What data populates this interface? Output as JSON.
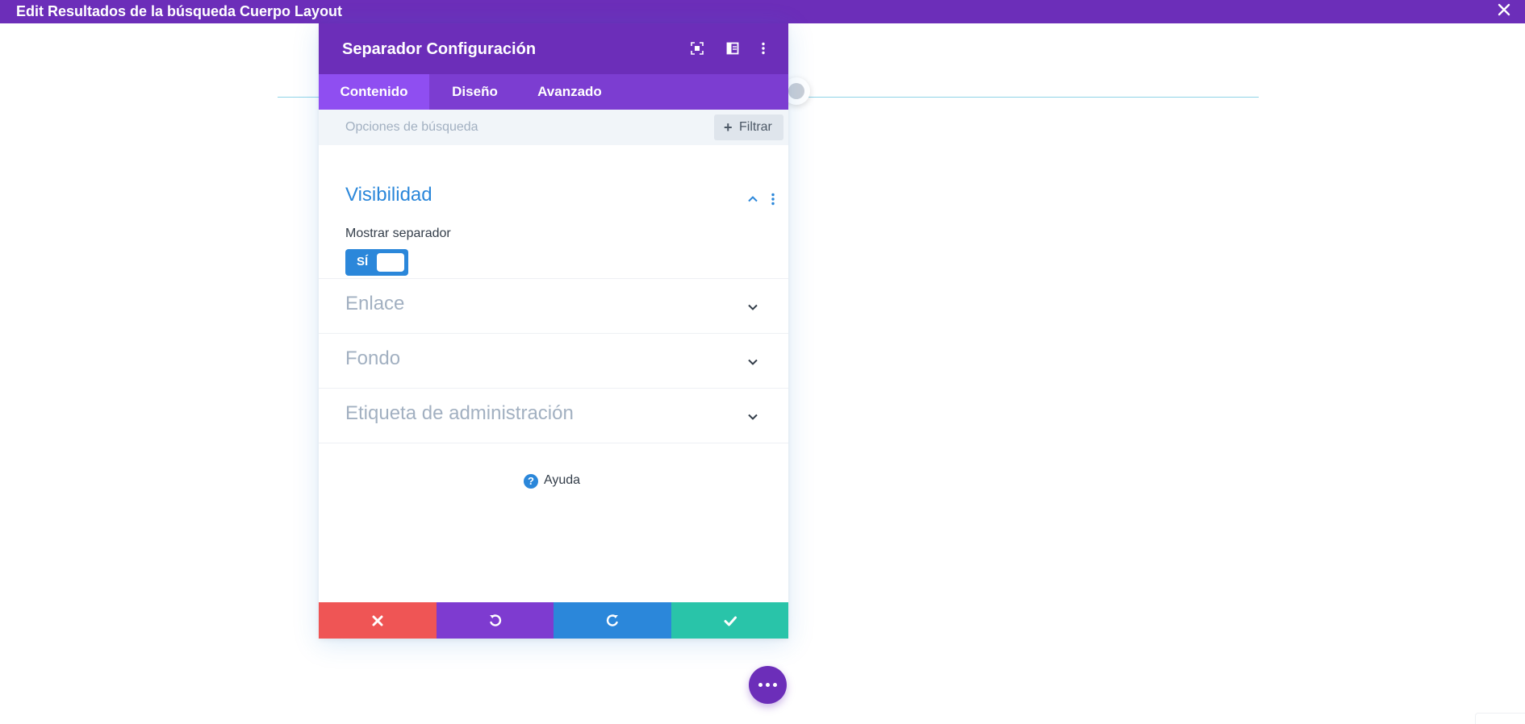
{
  "topbar": {
    "title": "Edit Resultados de la búsqueda Cuerpo Layout",
    "color": "#6c2eb9"
  },
  "modal": {
    "title": "Separador Configuración",
    "tabs": [
      {
        "label": "Contenido",
        "active": true
      },
      {
        "label": "Diseño",
        "active": false
      },
      {
        "label": "Avanzado",
        "active": false
      }
    ],
    "search": {
      "placeholder": "Opciones de búsqueda"
    },
    "filter": {
      "label": "Filtrar"
    },
    "visibility": {
      "title": "Visibilidad",
      "expanded": true,
      "field_label": "Mostrar separador",
      "toggle_label": "SÍ",
      "toggle_on": true
    },
    "sections": [
      {
        "title": "Enlace"
      },
      {
        "title": "Fondo"
      },
      {
        "title": "Etiqueta de administración"
      }
    ],
    "help": {
      "label": "Ayuda"
    },
    "footer": {
      "colors": {
        "cancel": "#ef5555",
        "undo": "#7e3bd0",
        "redo": "#2b87da",
        "save": "#29c4a9"
      }
    }
  },
  "colors": {
    "accent": "#2b87da",
    "primary": "#6c2eb9"
  }
}
